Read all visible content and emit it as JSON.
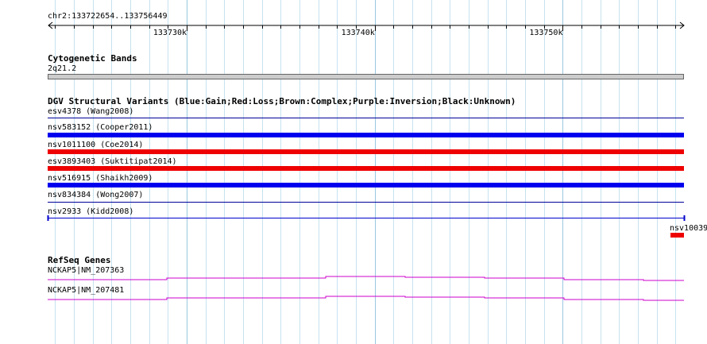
{
  "ruler": {
    "region": "chr2:133722654..133756449",
    "ticks": [
      {
        "label": "133730k",
        "pos": 133730000
      },
      {
        "label": "133740k",
        "pos": 133740000
      },
      {
        "label": "133750k",
        "pos": 133750000
      }
    ]
  },
  "cytoband_track": {
    "title": "Cytogenetic Bands",
    "band": "2q21.2",
    "color": "#cccccc"
  },
  "dgv_track": {
    "title": "DGV Structural Variants (Blue:Gain;Red:Loss;Brown:Complex;Purple:Inversion;Black:Unknown)",
    "colors": {
      "gain": "#0000ee",
      "loss": "#ee0000",
      "unknown": "#000000"
    },
    "features": [
      {
        "name": "esv4378 (Wang2008)",
        "type": "none"
      },
      {
        "name": "nsv583152 (Cooper2011)",
        "type": "gain"
      },
      {
        "name": "nsv1011100 (Coe2014)",
        "type": "loss"
      },
      {
        "name": "esv3893403 (Suktitipat2014)",
        "type": "loss"
      },
      {
        "name": "nsv516915 (Shaikh2009)",
        "type": "gain"
      },
      {
        "name": "nsv834384 (Wong2007)",
        "type": "none"
      },
      {
        "name": "nsv2933 (Kidd2008)",
        "type": "none"
      }
    ],
    "extra_feature": {
      "name": "nsv10039",
      "type": "loss"
    }
  },
  "refseq_track": {
    "title": "RefSeq Genes",
    "color": "#cc00cc",
    "genes": [
      {
        "name": "NCKAP5|NM_207363"
      },
      {
        "name": "NCKAP5|NM_207481"
      }
    ]
  }
}
